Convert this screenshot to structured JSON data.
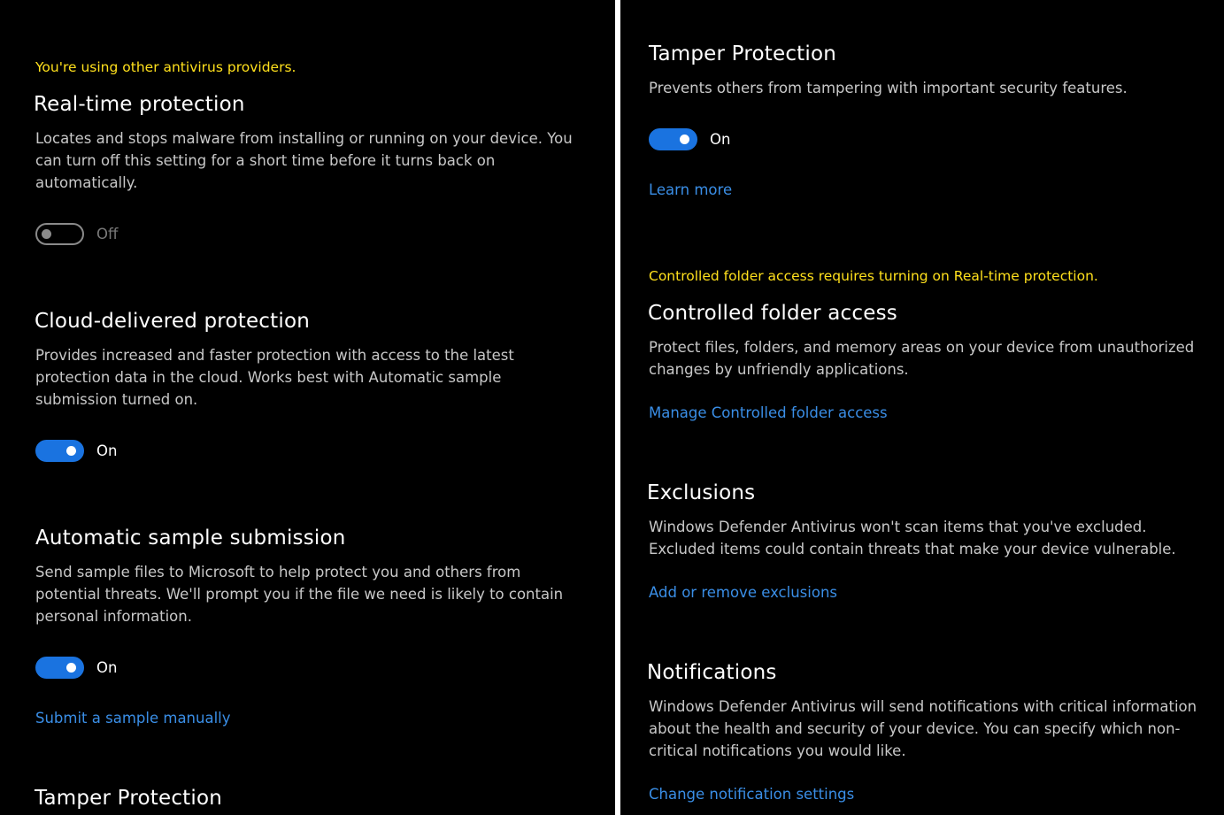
{
  "left": {
    "realtime": {
      "warning": "You're using other antivirus providers.",
      "title": "Real-time protection",
      "description": "Locates and stops malware from installing or running on your device. You can turn off this setting for a short time before it turns back on automatically.",
      "toggle_label": "Off",
      "toggle_state": "off"
    },
    "cloud": {
      "title": "Cloud-delivered protection",
      "description": "Provides increased and faster protection with access to the latest protection data in the cloud. Works best with Automatic sample submission turned on.",
      "toggle_label": "On",
      "toggle_state": "on"
    },
    "sample": {
      "title": "Automatic sample submission",
      "description": "Send sample files to Microsoft to help protect you and others from potential threats. We'll prompt you if the file we need is likely to contain personal information.",
      "toggle_label": "On",
      "toggle_state": "on",
      "link": "Submit a sample manually"
    },
    "tamper_partial": {
      "title": "Tamper Protection"
    }
  },
  "right": {
    "tamper": {
      "title": "Tamper Protection",
      "description": "Prevents others from tampering with important security features.",
      "toggle_label": "On",
      "toggle_state": "on",
      "link": "Learn more"
    },
    "cfa": {
      "warning": "Controlled folder access requires turning on Real-time protection.",
      "title": "Controlled folder access",
      "description": "Protect files, folders, and memory areas on your device from unauthorized changes by unfriendly applications.",
      "link": "Manage Controlled folder access"
    },
    "exclusions": {
      "title": "Exclusions",
      "description": "Windows Defender Antivirus won't scan items that you've excluded. Excluded items could contain threats that make your device vulnerable.",
      "link": "Add or remove exclusions"
    },
    "notifications": {
      "title": "Notifications",
      "description": "Windows Defender Antivirus will send notifications with critical information about the health and security of your device. You can specify which non-critical notifications you would like.",
      "link": "Change notification settings"
    }
  },
  "colors": {
    "background": "#000000",
    "warning": "#ffe01c",
    "link": "#3a8ee6",
    "toggle_on": "#1a73e0",
    "toggle_off": "#8a8a8a",
    "divider": "#ffffff"
  }
}
